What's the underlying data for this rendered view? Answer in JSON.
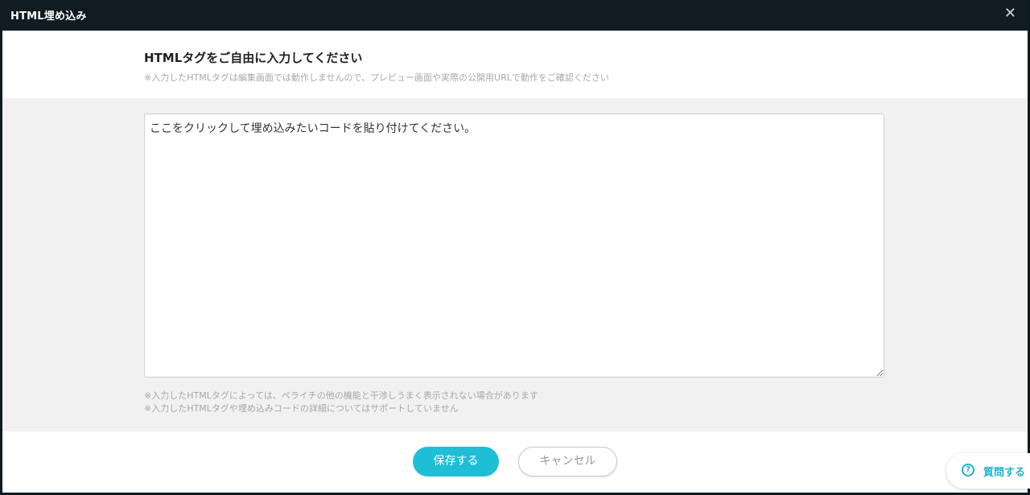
{
  "dialog": {
    "title": "HTML埋め込み",
    "close_label": "✕"
  },
  "header": {
    "heading": "HTMLタグをご自由に入力してください",
    "subtext": "※入力したHTMLタグは編集画面では動作しませんので、プレビュー画面や実際の公開用URLで動作をご確認ください"
  },
  "editor": {
    "placeholder": "ここをクリックして埋め込みたいコードを貼り付けてください。",
    "value": ""
  },
  "notes": [
    "※入力したHTMLタグによっては、ペライチの他の機能と干渉しうまく表示されない場合があります",
    "※入力したHTMLタグや埋め込みコードの詳細についてはサポートしていません"
  ],
  "footer": {
    "save_label": "保存する",
    "cancel_label": "キャンセル"
  },
  "help": {
    "icon": "?",
    "label": "質問する"
  },
  "colors": {
    "accent": "#1ebfd6",
    "titlebar": "#101c22"
  }
}
